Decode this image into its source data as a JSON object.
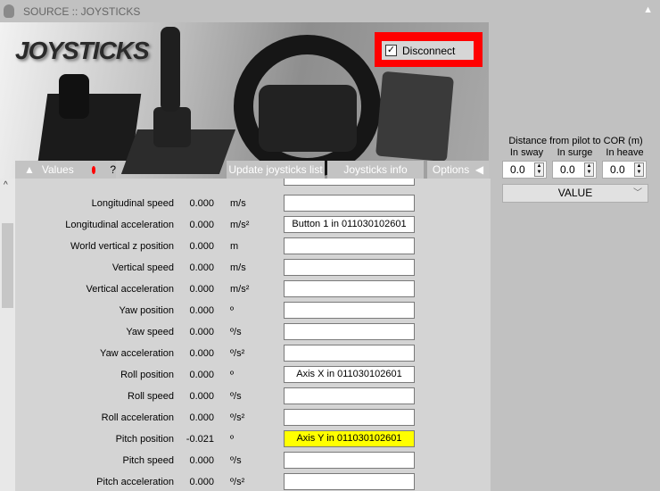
{
  "window": {
    "title": "SOURCE :: JOYSTICKS"
  },
  "banner": {
    "brand": "JOYSTICKS",
    "disconnect_label": "Disconnect",
    "disconnect_checked": true
  },
  "tabs": {
    "values": "Values",
    "help": "?",
    "update": "Update joysticks list",
    "info": "Joysticks info",
    "options": "Options"
  },
  "rows": [
    {
      "label": "",
      "value": "",
      "unit": "",
      "assign": ""
    },
    {
      "label": "Longitudinal speed",
      "value": "0.000",
      "unit": "m/s",
      "assign": ""
    },
    {
      "label": "Longitudinal acceleration",
      "value": "0.000",
      "unit": "m/s²",
      "assign": "Button 1 in 011030102601"
    },
    {
      "label": "World vertical z position",
      "value": "0.000",
      "unit": "m",
      "assign": ""
    },
    {
      "label": "Vertical speed",
      "value": "0.000",
      "unit": "m/s",
      "assign": ""
    },
    {
      "label": "Vertical acceleration",
      "value": "0.000",
      "unit": "m/s²",
      "assign": ""
    },
    {
      "label": "Yaw position",
      "value": "0.000",
      "unit": "º",
      "assign": ""
    },
    {
      "label": "Yaw speed",
      "value": "0.000",
      "unit": "º/s",
      "assign": ""
    },
    {
      "label": "Yaw acceleration",
      "value": "0.000",
      "unit": "º/s²",
      "assign": ""
    },
    {
      "label": "Roll position",
      "value": "0.000",
      "unit": "º",
      "assign": "Axis X in 011030102601"
    },
    {
      "label": "Roll speed",
      "value": "0.000",
      "unit": "º/s",
      "assign": ""
    },
    {
      "label": "Roll acceleration",
      "value": "0.000",
      "unit": "º/s²",
      "assign": ""
    },
    {
      "label": "Pitch position",
      "value": "-0.021",
      "unit": "º",
      "assign": "Axis Y in 011030102601",
      "highlight": true
    },
    {
      "label": "Pitch speed",
      "value": "0.000",
      "unit": "º/s",
      "assign": ""
    },
    {
      "label": "Pitch acceleration",
      "value": "0.000",
      "unit": "º/s²",
      "assign": ""
    },
    {
      "label": "",
      "value": "",
      "unit": "",
      "assign": ""
    }
  ],
  "cor": {
    "title": "Distance from pilot to COR (m)",
    "sway_label": "In sway",
    "surge_label": "In surge",
    "heave_label": "In heave",
    "sway": "0.0",
    "surge": "0.0",
    "heave": "0.0",
    "mode": "VALUE"
  }
}
